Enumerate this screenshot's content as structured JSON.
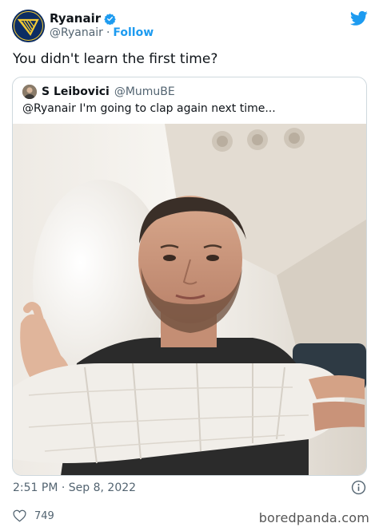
{
  "header": {
    "display_name": "Ryanair",
    "handle": "@Ryanair",
    "separator": "·",
    "follow_label": "Follow",
    "avatar_icon": "ryanair-harp-logo",
    "verified_icon": "verified-badge-icon",
    "platform_icon": "twitter-bird-icon"
  },
  "tweet": {
    "text": "You didn't learn the first time?",
    "timestamp": "2:51 PM · Sep 8, 2022",
    "likes": "749"
  },
  "quote": {
    "display_name": "S Leibovici",
    "handle": "@MumuBE",
    "text": "@Ryanair I'm going to clap again next time..."
  },
  "footer": {
    "watermark": "boredpanda.com"
  },
  "colors": {
    "accent": "#1d9bf0",
    "ryanair_navy": "#0c2d63",
    "ryanair_gold": "#f1c933",
    "muted": "#536471",
    "border": "#cfd9de"
  }
}
